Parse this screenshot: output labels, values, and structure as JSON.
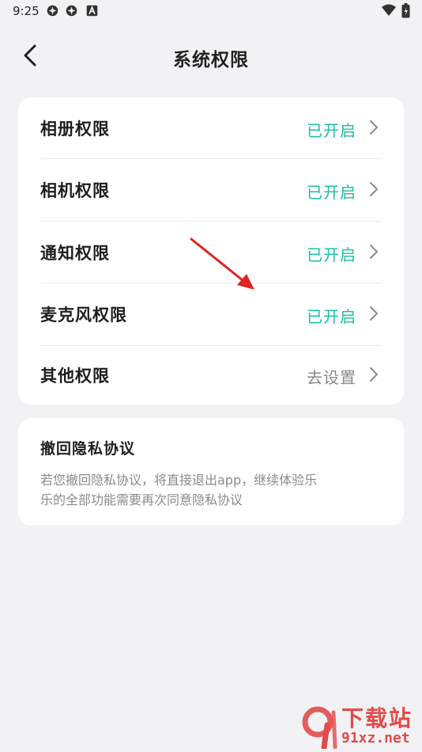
{
  "status_bar": {
    "time": "9:25"
  },
  "header": {
    "title": "系统权限"
  },
  "permissions": [
    {
      "label": "相册权限",
      "status": "已开启"
    },
    {
      "label": "相机权限",
      "status": "已开启"
    },
    {
      "label": "通知权限",
      "status": "已开启"
    },
    {
      "label": "麦克风权限",
      "status": "已开启"
    },
    {
      "label": "其他权限",
      "status": "去设置"
    }
  ],
  "privacy": {
    "title": "撤回隐私协议",
    "description": "若您撤回隐私协议，将直接退出app，继续体验乐乐的全部功能需要再次同意隐私协议"
  },
  "watermark": {
    "text": "下载站",
    "url": "91xz.net"
  },
  "colors": {
    "accent": "#1bbfa3",
    "background": "#f2f2f4",
    "annotation_arrow": "#e02424"
  }
}
